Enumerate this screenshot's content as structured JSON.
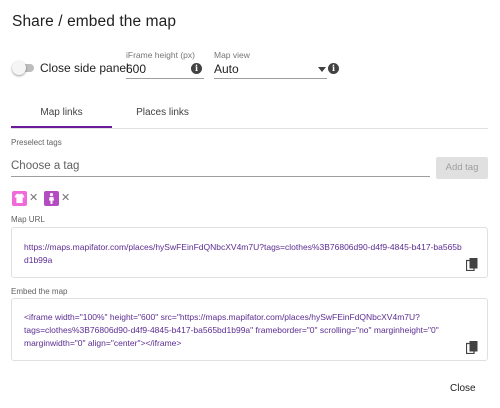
{
  "dialog": {
    "title": "Share / embed the map",
    "close_label": "Close"
  },
  "controls": {
    "toggle_label": "Close side panel",
    "toggle_on": false,
    "iframe_height": {
      "label": "iFrame height (px)",
      "value": "600",
      "icon": "info-icon"
    },
    "map_view": {
      "label": "Map view",
      "value": "Auto",
      "icon": "info-icon"
    }
  },
  "tabs": [
    {
      "label": "Map links",
      "active": true
    },
    {
      "label": "Places links",
      "active": false
    }
  ],
  "tags": {
    "section_label": "Preselect tags",
    "placeholder": "Choose a tag",
    "add_label": "Add tag",
    "selected": [
      {
        "icon": "tshirt-icon",
        "color": "#f06bd9"
      },
      {
        "icon": "person-icon",
        "color": "#b44bc2"
      }
    ],
    "remove_glyph": "✕"
  },
  "map_url": {
    "label": "Map URL",
    "value": "https://maps.mapifator.com/places/hySwFEinFdQNbcXV4m7U?tags=clothes%3B76806d90-d4f9-4845-b417-ba565bd1b99a",
    "copy_icon": "copy-icon"
  },
  "embed": {
    "label": "Embed the map",
    "value": "<iframe width=\"100%\" height=\"600\" src=\"https://maps.mapifator.com/places/hySwFEinFdQNbcXV4m7U?tags=clothes%3B76806d90-d4f9-4845-b417-ba565bd1b99a\" frameborder=\"0\" scrolling=\"no\" marginheight=\"0\" marginwidth=\"0\" align=\"center\"></iframe>",
    "copy_icon": "copy-icon"
  },
  "colors": {
    "accent": "#6a1b9a",
    "link_text": "#5c2d91"
  }
}
